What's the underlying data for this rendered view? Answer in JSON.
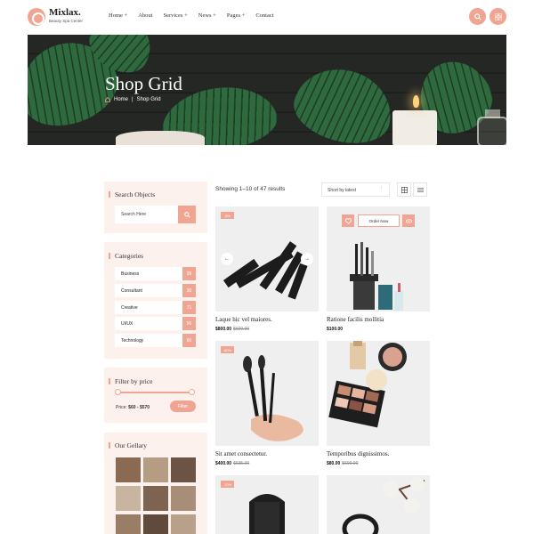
{
  "brand": {
    "name": "Mixlax.",
    "tagline": "Beauty Spa Center"
  },
  "nav": [
    "Home +",
    "About",
    "Services +",
    "News +",
    "Pages +",
    "Contact"
  ],
  "header_icons": [
    "search-icon",
    "grid-icon"
  ],
  "banner": {
    "title": "Shop Grid",
    "breadcrumb": [
      "Home",
      "Shop Grid"
    ],
    "separator": "|"
  },
  "search": {
    "title": "Search Objects",
    "placeholder": "Search Here"
  },
  "categories": {
    "title": "Categories",
    "items": [
      {
        "label": "Business",
        "count": "26"
      },
      {
        "label": "Consultant",
        "count": "30"
      },
      {
        "label": "Creative",
        "count": "71"
      },
      {
        "label": "UI/UX",
        "count": "56"
      },
      {
        "label": "Technology",
        "count": "60"
      }
    ]
  },
  "price_filter": {
    "title": "Filter by price",
    "label": "Price:",
    "range": "$60 - $570",
    "button": "Filter"
  },
  "gallery": {
    "title": "Our Gellary"
  },
  "toolbar": {
    "showing": "Showing 1–10 of 47 results",
    "sort": "Short by latest"
  },
  "products": [
    {
      "name": "Laque hic vel maiores.",
      "price": "$800.00",
      "old_price": "$920.00",
      "badge": "-8%"
    },
    {
      "name": "Ratione facilis mollitia",
      "price": "$100.00",
      "old_price": "",
      "badge": "",
      "order_label": "Order Now"
    },
    {
      "name": "Sit amet consectetur.",
      "price": "$400.00",
      "old_price": "$635.00",
      "badge": "-60%"
    },
    {
      "name": "Temporibus dignissimos.",
      "price": "$80.00",
      "old_price": "$690.00",
      "badge": ""
    },
    {
      "name": "",
      "price": "",
      "old_price": "",
      "badge": "-70%"
    },
    {
      "name": "",
      "price": "",
      "old_price": "",
      "badge": ""
    }
  ],
  "colors": {
    "accent": "#f0a593",
    "widget_bg": "#fdf1ee",
    "card_bg": "#efefef"
  }
}
